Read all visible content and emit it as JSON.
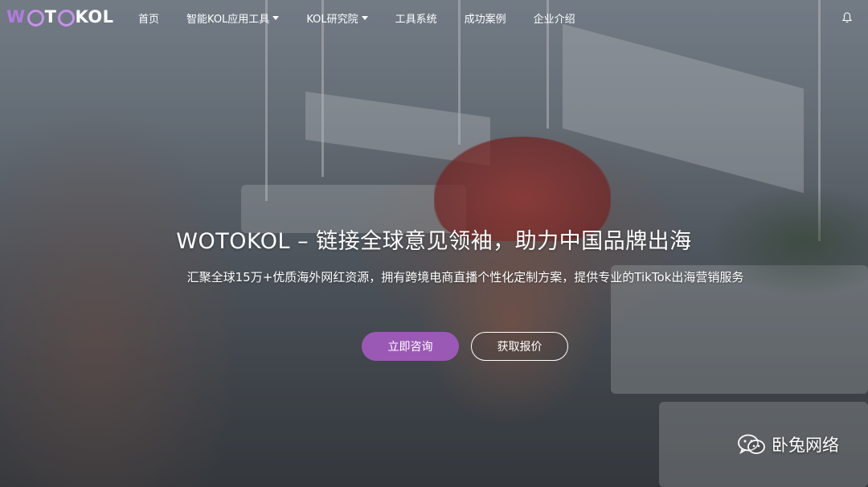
{
  "brand": {
    "logo_text": "WOTOKOL",
    "logo_prefix": "W",
    "logo_middle": "T",
    "logo_suffix": "KOL",
    "accent_color": "#9b59b6"
  },
  "nav": {
    "items": [
      {
        "label": "首页",
        "has_dropdown": false
      },
      {
        "label": "智能KOL应用工具",
        "has_dropdown": true
      },
      {
        "label": "KOL研究院",
        "has_dropdown": true
      },
      {
        "label": "工具系统",
        "has_dropdown": false
      },
      {
        "label": "成功案例",
        "has_dropdown": false
      },
      {
        "label": "企业介绍",
        "has_dropdown": false
      }
    ],
    "right_icon": "bell-icon"
  },
  "hero": {
    "title": "WOTOKOL – 链接全球意见领袖，助力中国品牌出海",
    "subtitle": "汇聚全球15万+优质海外网红资源，拥有跨境电商直播个性化定制方案，提供专业的TikTok出海营销服务",
    "primary_button": "立即咨询",
    "secondary_button": "获取报价"
  },
  "watermark": {
    "icon": "wechat-icon",
    "text": "卧兔网络"
  }
}
